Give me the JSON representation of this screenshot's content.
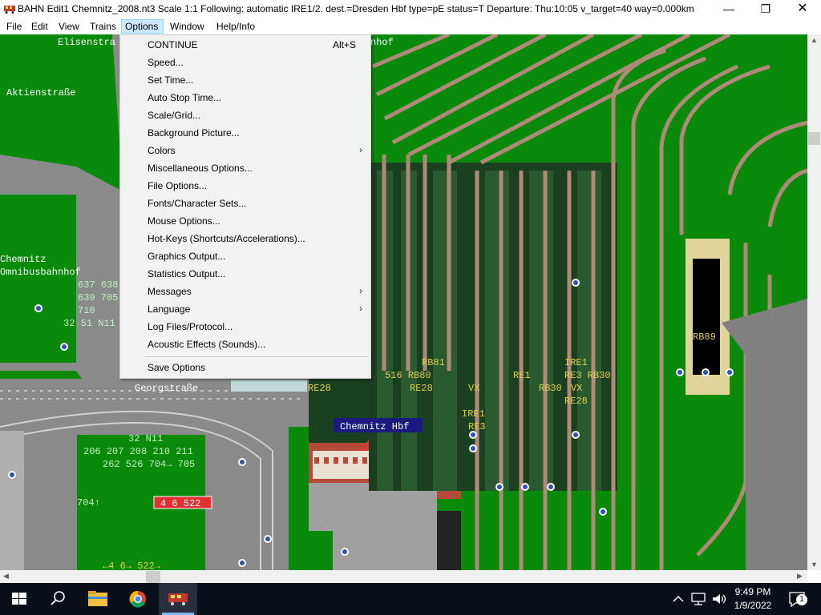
{
  "window": {
    "title": "BAHN Edit1 Chemnitz_2008.nt3 Scale 1:1 Following: automatic IRE1/2.  dest.=Dresden Hbf type=pE status=T  Departure: Thu:10:05 v_target=40 way=0.000km",
    "minimize": "—",
    "maximize": "❐",
    "close": "✕"
  },
  "menubar": [
    "File",
    "Edit",
    "View",
    "Trains",
    "Options",
    "Window",
    "Help/Info"
  ],
  "options_menu": {
    "items": [
      {
        "label": "CONTINUE",
        "shortcut": "Alt+S",
        "submenu": false
      },
      {
        "label": "Speed...",
        "shortcut": "",
        "submenu": false
      },
      {
        "label": "Set Time...",
        "shortcut": "",
        "submenu": false
      },
      {
        "label": "Auto Stop Time...",
        "shortcut": "",
        "submenu": false
      },
      {
        "label": "Scale/Grid...",
        "shortcut": "",
        "submenu": false
      },
      {
        "label": "Background Picture...",
        "shortcut": "",
        "submenu": false
      },
      {
        "label": "Colors",
        "shortcut": "",
        "submenu": true
      },
      {
        "label": "Miscellaneous Options...",
        "shortcut": "",
        "submenu": false
      },
      {
        "label": "File Options...",
        "shortcut": "",
        "submenu": false
      },
      {
        "label": "Fonts/Character Sets...",
        "shortcut": "",
        "submenu": false
      },
      {
        "label": "Mouse Options...",
        "shortcut": "",
        "submenu": false
      },
      {
        "label": "Hot-Keys (Shortcuts/Accelerations)...",
        "shortcut": "",
        "submenu": false
      },
      {
        "label": "Graphics Output...",
        "shortcut": "",
        "submenu": false
      },
      {
        "label": "Statistics Output...",
        "shortcut": "",
        "submenu": false
      },
      {
        "label": "Messages",
        "shortcut": "",
        "submenu": true
      },
      {
        "label": "Language",
        "shortcut": "",
        "submenu": true
      },
      {
        "label": "Log Files/Protocol...",
        "shortcut": "",
        "submenu": false
      },
      {
        "label": "Acoustic Effects (Sounds)...",
        "shortcut": "",
        "submenu": false
      }
    ],
    "footer_item": "Save Options",
    "submenu_arrow": "›"
  },
  "map": {
    "street_labels": {
      "elisenstrasse": "Elisenstra",
      "aktienstrasse": "Aktienstraße",
      "georgstrasse": "Georgstraße",
      "bahnhof_fragment": "nhof"
    },
    "bus_station": [
      "Chemnitz",
      "Omnibusbahnhof"
    ],
    "station_name": "Chemnitz Hbf",
    "bus_lines_left": [
      "637 638",
      "639 705",
      "710",
      "32 51 N11"
    ],
    "bus_lines_bottom": [
      "32 N11",
      "206 207 208 210 211",
      "262 526 704→ 705"
    ],
    "bus_704": "704↑",
    "red_sign": "4 6 522",
    "bottom_lines": "←4 6→ 522→",
    "train_labels": [
      "RE28",
      "516 RB80",
      "RE28",
      "RB81",
      "VX",
      "IRE1",
      "RE3",
      "RE1",
      "RB30",
      "IRE1",
      "RE3 RB30",
      "VX",
      "RE28",
      "RB89"
    ]
  },
  "taskbar": {
    "time": "9:49 PM",
    "date": "1/9/2022",
    "notifications": "1"
  },
  "colors": {
    "menu_highlight": "#cce8ff",
    "grass": "#0a8a0a",
    "track": "#b08a78",
    "platform": "#1a4020",
    "taskbar": "#0b0f1a"
  }
}
